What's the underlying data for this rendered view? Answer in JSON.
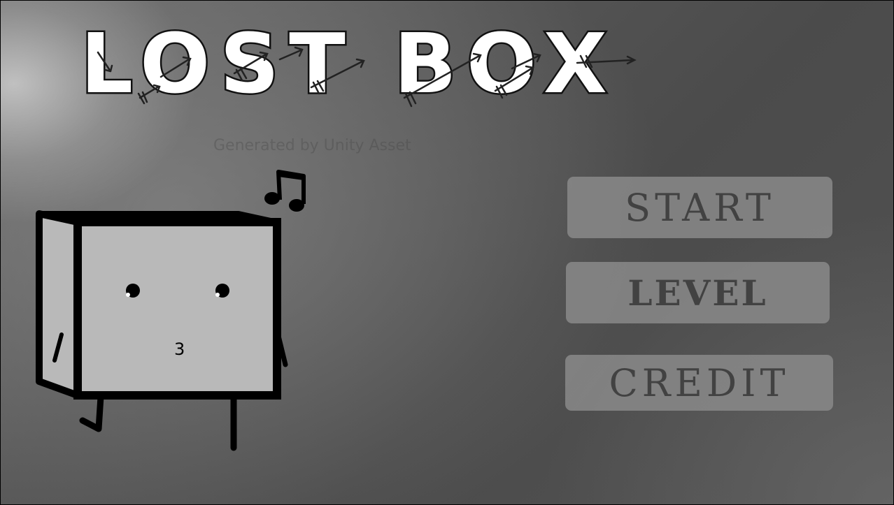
{
  "game": {
    "title": "LOST BOX",
    "watermark": "Generated by Unity Asset",
    "menu": {
      "start_label": "START",
      "level_label": "LEVEL",
      "credit_label": "CREDIT"
    },
    "character": {
      "mouth_glyph": "3"
    }
  },
  "colors": {
    "button_bg": "#8a8a8a",
    "button_text": "#424242",
    "box_face": "#b9b9b9",
    "outline": "#000000",
    "title_fill": "#ffffff"
  },
  "icons": [
    "music-note-icon",
    "arrow-doodle-icon"
  ]
}
